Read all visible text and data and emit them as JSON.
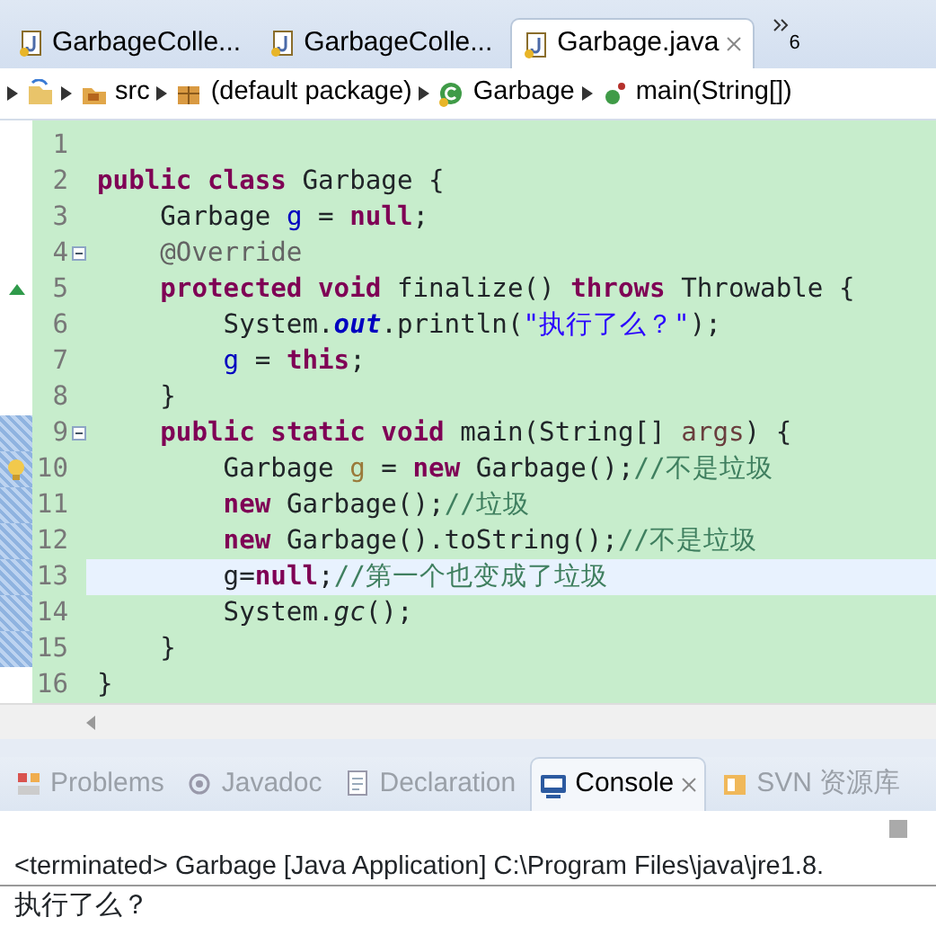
{
  "editor_tabs": [
    {
      "label": "GarbageColle...",
      "selected": false,
      "closable": false
    },
    {
      "label": "GarbageColle...",
      "selected": false,
      "closable": false
    },
    {
      "label": "Garbage.java",
      "selected": true,
      "closable": true
    }
  ],
  "tab_overflow": {
    "count": "6"
  },
  "breadcrumb": [
    {
      "kind": "project"
    },
    {
      "kind": "folder",
      "label": "src"
    },
    {
      "kind": "package",
      "label": "(default package)"
    },
    {
      "kind": "class",
      "label": "Garbage"
    },
    {
      "kind": "method",
      "label": "main(String[])"
    }
  ],
  "code_lines": [
    {
      "n": "1",
      "kind": "plain",
      "changed": false,
      "current": false
    },
    {
      "n": "2",
      "kind": "plain",
      "changed": false,
      "current": false,
      "tokens": [
        {
          "kind": "kw",
          "text": "public "
        },
        {
          "kind": "kw",
          "text": "class"
        },
        {
          "kind": "plain",
          "text": " Garbage {"
        }
      ]
    },
    {
      "n": "3",
      "kind": "plain",
      "changed": false,
      "current": false,
      "tokens": [
        {
          "kind": "plain",
          "text": "    Garbage "
        },
        {
          "kind": "field",
          "text": "g"
        },
        {
          "kind": "plain",
          "text": " = "
        },
        {
          "kind": "kw",
          "text": "null"
        },
        {
          "kind": "plain",
          "text": ";"
        }
      ]
    },
    {
      "n": "4",
      "kind": "fold",
      "changed": false,
      "current": false,
      "tokens": [
        {
          "kind": "annotation",
          "text": "    @Override"
        }
      ]
    },
    {
      "n": "5",
      "kind": "override",
      "changed": false,
      "current": false,
      "tokens": [
        {
          "kind": "kw",
          "text": "    protected "
        },
        {
          "kind": "kw",
          "text": "void"
        },
        {
          "kind": "plain",
          "text": " finalize() "
        },
        {
          "kind": "kw",
          "text": "throws"
        },
        {
          "kind": "plain",
          "text": " Throwable {"
        }
      ]
    },
    {
      "n": "6",
      "kind": "plain",
      "changed": false,
      "current": false,
      "tokens": [
        {
          "kind": "plain",
          "text": "        System."
        },
        {
          "kind": "static",
          "text": "out"
        },
        {
          "kind": "plain",
          "text": ".println("
        },
        {
          "kind": "string",
          "text": "\"执行了么？\""
        },
        {
          "kind": "plain",
          "text": ");"
        }
      ]
    },
    {
      "n": "7",
      "kind": "plain",
      "changed": false,
      "current": false,
      "tokens": [
        {
          "kind": "field",
          "text": "        g"
        },
        {
          "kind": "plain",
          "text": " = "
        },
        {
          "kind": "kw",
          "text": "this"
        },
        {
          "kind": "plain",
          "text": ";"
        }
      ]
    },
    {
      "n": "8",
      "kind": "plain",
      "changed": false,
      "current": false,
      "tokens": [
        {
          "kind": "plain",
          "text": "    }"
        }
      ]
    },
    {
      "n": "9",
      "kind": "fold",
      "changed": true,
      "current": false,
      "tokens": [
        {
          "kind": "kw",
          "text": "    public "
        },
        {
          "kind": "kw",
          "text": "static "
        },
        {
          "kind": "kw",
          "text": "void"
        },
        {
          "kind": "plain",
          "text": " main(String[] "
        },
        {
          "kind": "param",
          "text": "args"
        },
        {
          "kind": "plain",
          "text": ") {"
        }
      ]
    },
    {
      "n": "10",
      "kind": "warning",
      "changed": true,
      "current": false,
      "tokens": [
        {
          "kind": "plain",
          "text": "        Garbage "
        },
        {
          "kind": "unused",
          "text": "g"
        },
        {
          "kind": "plain",
          "text": " = "
        },
        {
          "kind": "kw",
          "text": "new"
        },
        {
          "kind": "plain",
          "text": " Garbage();"
        },
        {
          "kind": "comment",
          "text": "//不是垃圾"
        }
      ]
    },
    {
      "n": "11",
      "kind": "plain",
      "changed": true,
      "current": false,
      "tokens": [
        {
          "kind": "kw",
          "text": "        new"
        },
        {
          "kind": "plain",
          "text": " Garbage();"
        },
        {
          "kind": "comment",
          "text": "//垃圾"
        }
      ]
    },
    {
      "n": "12",
      "kind": "plain",
      "changed": true,
      "current": false,
      "tokens": [
        {
          "kind": "kw",
          "text": "        new"
        },
        {
          "kind": "plain",
          "text": " Garbage().toString();"
        },
        {
          "kind": "comment",
          "text": "//不是垃圾"
        }
      ]
    },
    {
      "n": "13",
      "kind": "plain",
      "changed": true,
      "current": true,
      "tokens": [
        {
          "kind": "plain",
          "text": "        g="
        },
        {
          "kind": "kw",
          "text": "null"
        },
        {
          "kind": "plain",
          "text": ";"
        },
        {
          "kind": "comment",
          "text": "//第一个也变成了垃圾"
        }
      ]
    },
    {
      "n": "14",
      "kind": "plain",
      "changed": true,
      "current": false,
      "tokens": [
        {
          "kind": "plain",
          "text": "        System."
        },
        {
          "kind": "staticmethod",
          "text": "gc"
        },
        {
          "kind": "plain",
          "text": "();"
        }
      ]
    },
    {
      "n": "15",
      "kind": "plain",
      "changed": true,
      "current": false,
      "tokens": [
        {
          "kind": "plain",
          "text": "    }"
        }
      ]
    },
    {
      "n": "16",
      "kind": "plain",
      "changed": false,
      "current": false,
      "tokens": [
        {
          "kind": "plain",
          "text": "}"
        }
      ]
    }
  ],
  "view_tabs": [
    {
      "kind": "problems",
      "label": "Problems",
      "selected": false,
      "closable": false
    },
    {
      "kind": "javadoc",
      "label": "Javadoc",
      "selected": false,
      "closable": false
    },
    {
      "kind": "declaration",
      "label": "Declaration",
      "selected": false,
      "closable": false
    },
    {
      "kind": "console",
      "label": "Console",
      "selected": true,
      "closable": true
    },
    {
      "kind": "svn",
      "label": "SVN 资源库",
      "selected": false,
      "closable": false
    }
  ],
  "console": {
    "header": "<terminated> Garbage [Java Application] C:\\Program Files\\java\\jre1.8.",
    "output": "执行了么？"
  }
}
